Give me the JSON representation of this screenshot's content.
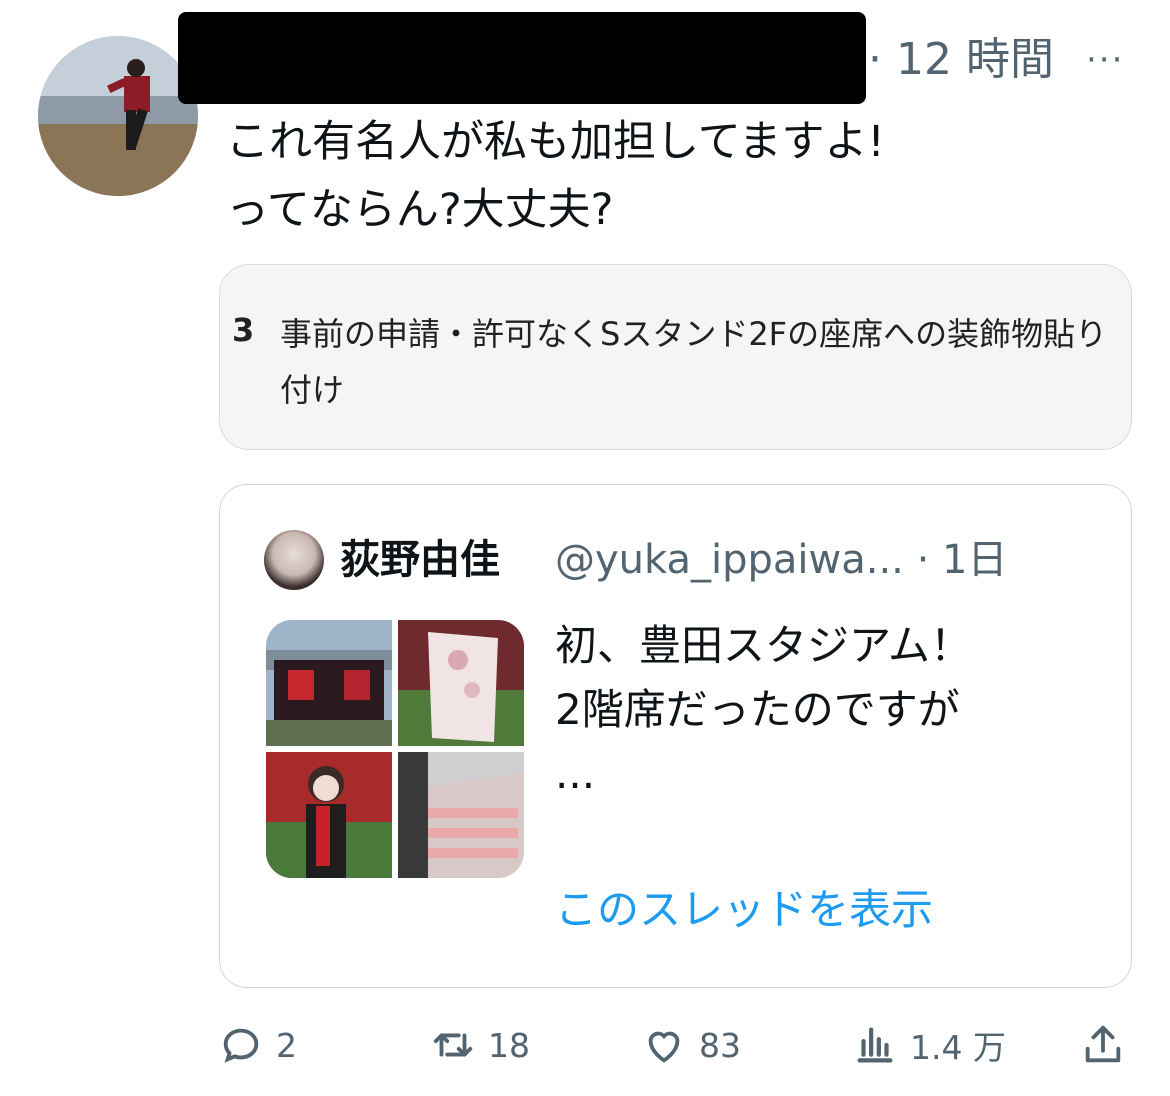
{
  "tweet": {
    "time": "· 12 時間",
    "more_label": "···",
    "text": "これ有名人が私も加担してますよ!\nってならん?大丈夫?"
  },
  "attached_image": {
    "number": "3",
    "text": "事前の申請・許可なくSスタンド2Fの座席への装飾物貼り付け"
  },
  "quote": {
    "name": "荻野由佳",
    "handle_time": "@yuka_ippaiwa... · 1日",
    "text": "初、豊田スタジアム！\n2階席だったのですが\n...",
    "show_thread": "このスレッドを表示"
  },
  "actions": {
    "replies": "2",
    "retweets": "18",
    "likes": "83",
    "views": "1.4 万"
  },
  "colors": {
    "accent": "#1d9bf0",
    "secondary_text": "#536471",
    "primary_text": "#0f1419",
    "border": "#cfd9de"
  }
}
